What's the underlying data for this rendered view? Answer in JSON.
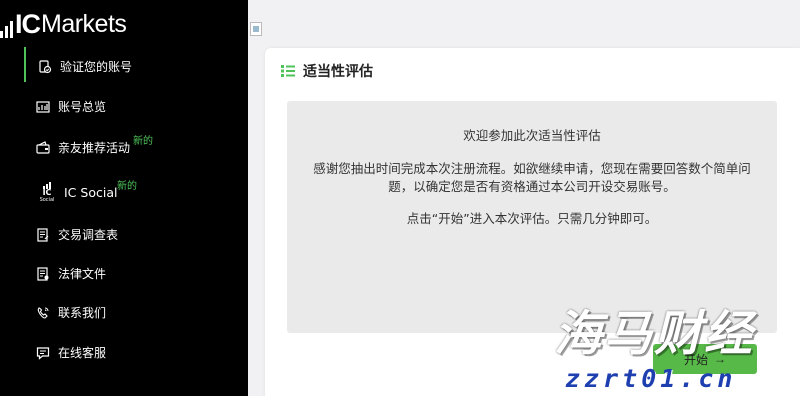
{
  "brand": {
    "ic": "IC",
    "markets": "Markets",
    "accent": "#4fc35a"
  },
  "sidebar": {
    "items": [
      {
        "label": "验证您的账号",
        "icon": "verify-account-icon",
        "active": true
      },
      {
        "label": "账号总览",
        "icon": "chart-overview-icon"
      },
      {
        "label": "亲友推荐活动",
        "icon": "wallet-referral-icon",
        "badge": "新的"
      },
      {
        "label": "IC Social",
        "icon": "ic-social-icon",
        "badge": "新的",
        "icon_text": {
          "ic": "IC",
          "social": "Social"
        }
      },
      {
        "label": "交易调查表",
        "icon": "questionnaire-icon"
      },
      {
        "label": "法律文件",
        "icon": "legal-document-icon"
      },
      {
        "label": "联系我们",
        "icon": "phone-contact-icon"
      },
      {
        "label": "在线客服",
        "icon": "chat-support-icon"
      }
    ]
  },
  "main": {
    "card_title": "适当性评估",
    "info": {
      "heading": "欢迎参加此次适当性评估",
      "paragraph_line1": "感谢您抽出时间完成本次注册流程。如欲继续申请，您现在需要回答数个简单问",
      "paragraph_line2": "题，以确定您是否有资格通过本公司开设交易账号。",
      "instruction": "点击“开始”进入本次评估。只需几分钟即可。"
    },
    "start_button": "开始",
    "start_button_icon": "arrow-right-icon"
  },
  "watermark": {
    "main": "海马财经",
    "url": "zzrt01.cn"
  }
}
